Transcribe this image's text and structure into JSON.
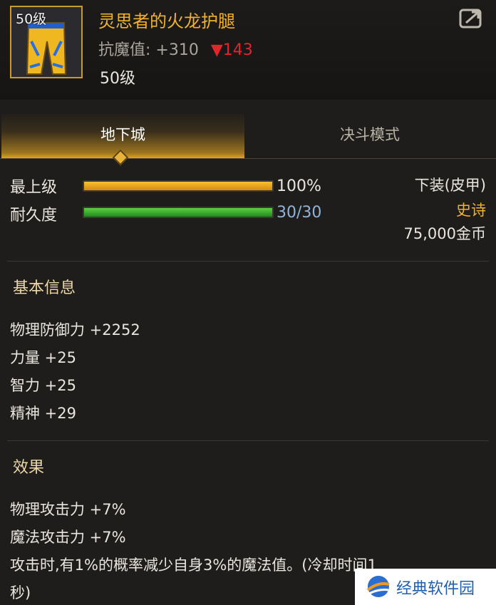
{
  "item": {
    "icon_level": "50级",
    "name": "灵思者的火龙护腿",
    "stat_label": "抗魔值:",
    "stat_value": "+310",
    "stat_change": "▼143",
    "level": "50级",
    "icon": "share-icon"
  },
  "tabs": [
    {
      "label": "地下城",
      "active": true
    },
    {
      "label": "决斗模式",
      "active": false
    }
  ],
  "bars": {
    "grade": {
      "label": "最上级",
      "value_text": "100%",
      "fill": 1.0
    },
    "durability": {
      "label": "耐久度",
      "value_text": "30/30",
      "fill": 1.0
    }
  },
  "info": {
    "type": "下装(皮甲)",
    "rarity": "史诗",
    "price": "75,000金币"
  },
  "basic": {
    "title": "基本信息",
    "lines": [
      "物理防御力 +2252",
      "力量 +25",
      "智力 +25",
      "精神 +29"
    ]
  },
  "effects": {
    "title": "效果",
    "lines": [
      "物理攻击力 +7%",
      "魔法攻击力 +7%",
      "攻击时,有1%的概率减少自身3%的魔法值。(冷却时间1",
      "秒)"
    ]
  },
  "watermark": {
    "text": "经典软件园"
  },
  "colors": {
    "title": "#f0b22c",
    "rarity": "#f0b22c",
    "durability_text": "#8fb4d8",
    "down": "#e0262d"
  }
}
